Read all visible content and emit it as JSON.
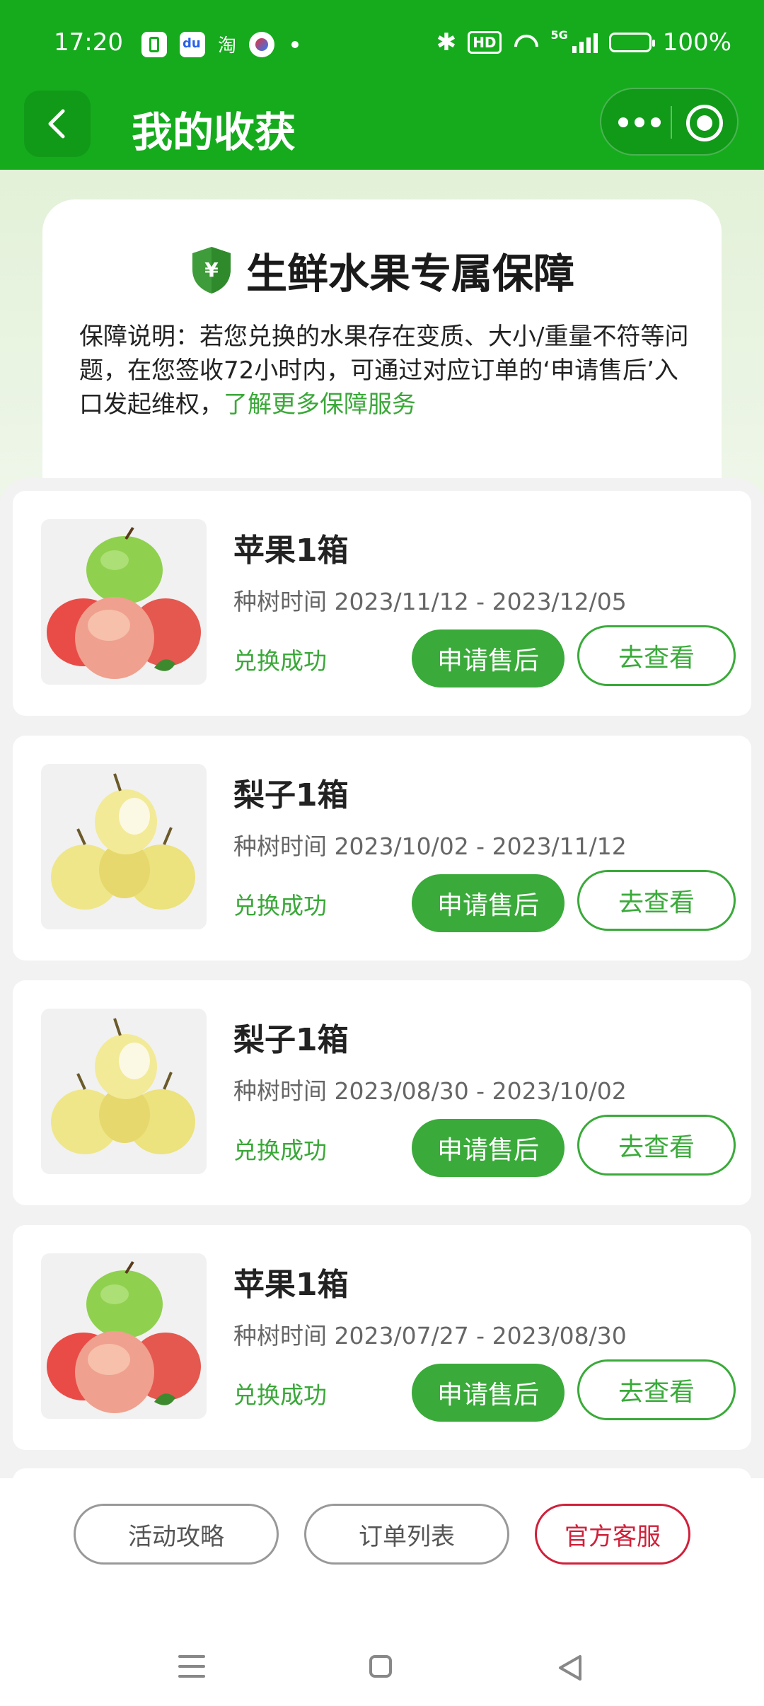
{
  "status_bar": {
    "time": "17:20",
    "app_icons": [
      "sim-card-icon",
      "baidu-icon",
      "taobao-icon",
      "browser-icon"
    ],
    "taobao_glyph": "淘",
    "hd_label": "HD",
    "network_label": "5G",
    "battery": "100%"
  },
  "header": {
    "title": "我的收获",
    "back_icon": "chevron-left-icon",
    "more_icon": "more-dots-icon",
    "close_icon": "target-circle-icon"
  },
  "guarantee": {
    "title": "生鲜水果专属保障",
    "shield_icon": "shield-yen-icon",
    "description": "保障说明：若您兑换的水果存在变质、大小/重量不符等问题，在您签收72小时内，可通过对应订单的‘申请售后’入口发起维权，",
    "link_text": "了解更多保障服务"
  },
  "orders": [
    {
      "name": "苹果1箱",
      "time": "种树时间 2023/11/12 - 2023/12/05",
      "status": "兑换成功",
      "fruit": "apple",
      "after_sale_label": "申请售后",
      "view_label": "去查看"
    },
    {
      "name": "梨子1箱",
      "time": "种树时间 2023/10/02 - 2023/11/12",
      "status": "兑换成功",
      "fruit": "pear",
      "after_sale_label": "申请售后",
      "view_label": "去查看"
    },
    {
      "name": "梨子1箱",
      "time": "种树时间 2023/08/30 - 2023/10/02",
      "status": "兑换成功",
      "fruit": "pear",
      "after_sale_label": "申请售后",
      "view_label": "去查看"
    },
    {
      "name": "苹果1箱",
      "time": "种树时间 2023/07/27 - 2023/08/30",
      "status": "兑换成功",
      "fruit": "apple",
      "after_sale_label": "申请售后",
      "view_label": "去查看"
    }
  ],
  "bottom_actions": {
    "strategy": "活动攻略",
    "orders": "订单列表",
    "service": "官方客服"
  },
  "nav_bar": {
    "menu_icon": "menu-icon",
    "home_icon": "home-square-icon",
    "back_icon": "back-triangle-icon"
  },
  "colors": {
    "brand_green": "#15ab1d",
    "button_green": "#3aaa3a",
    "status_green": "#3aa838",
    "service_red": "#d0203a"
  }
}
